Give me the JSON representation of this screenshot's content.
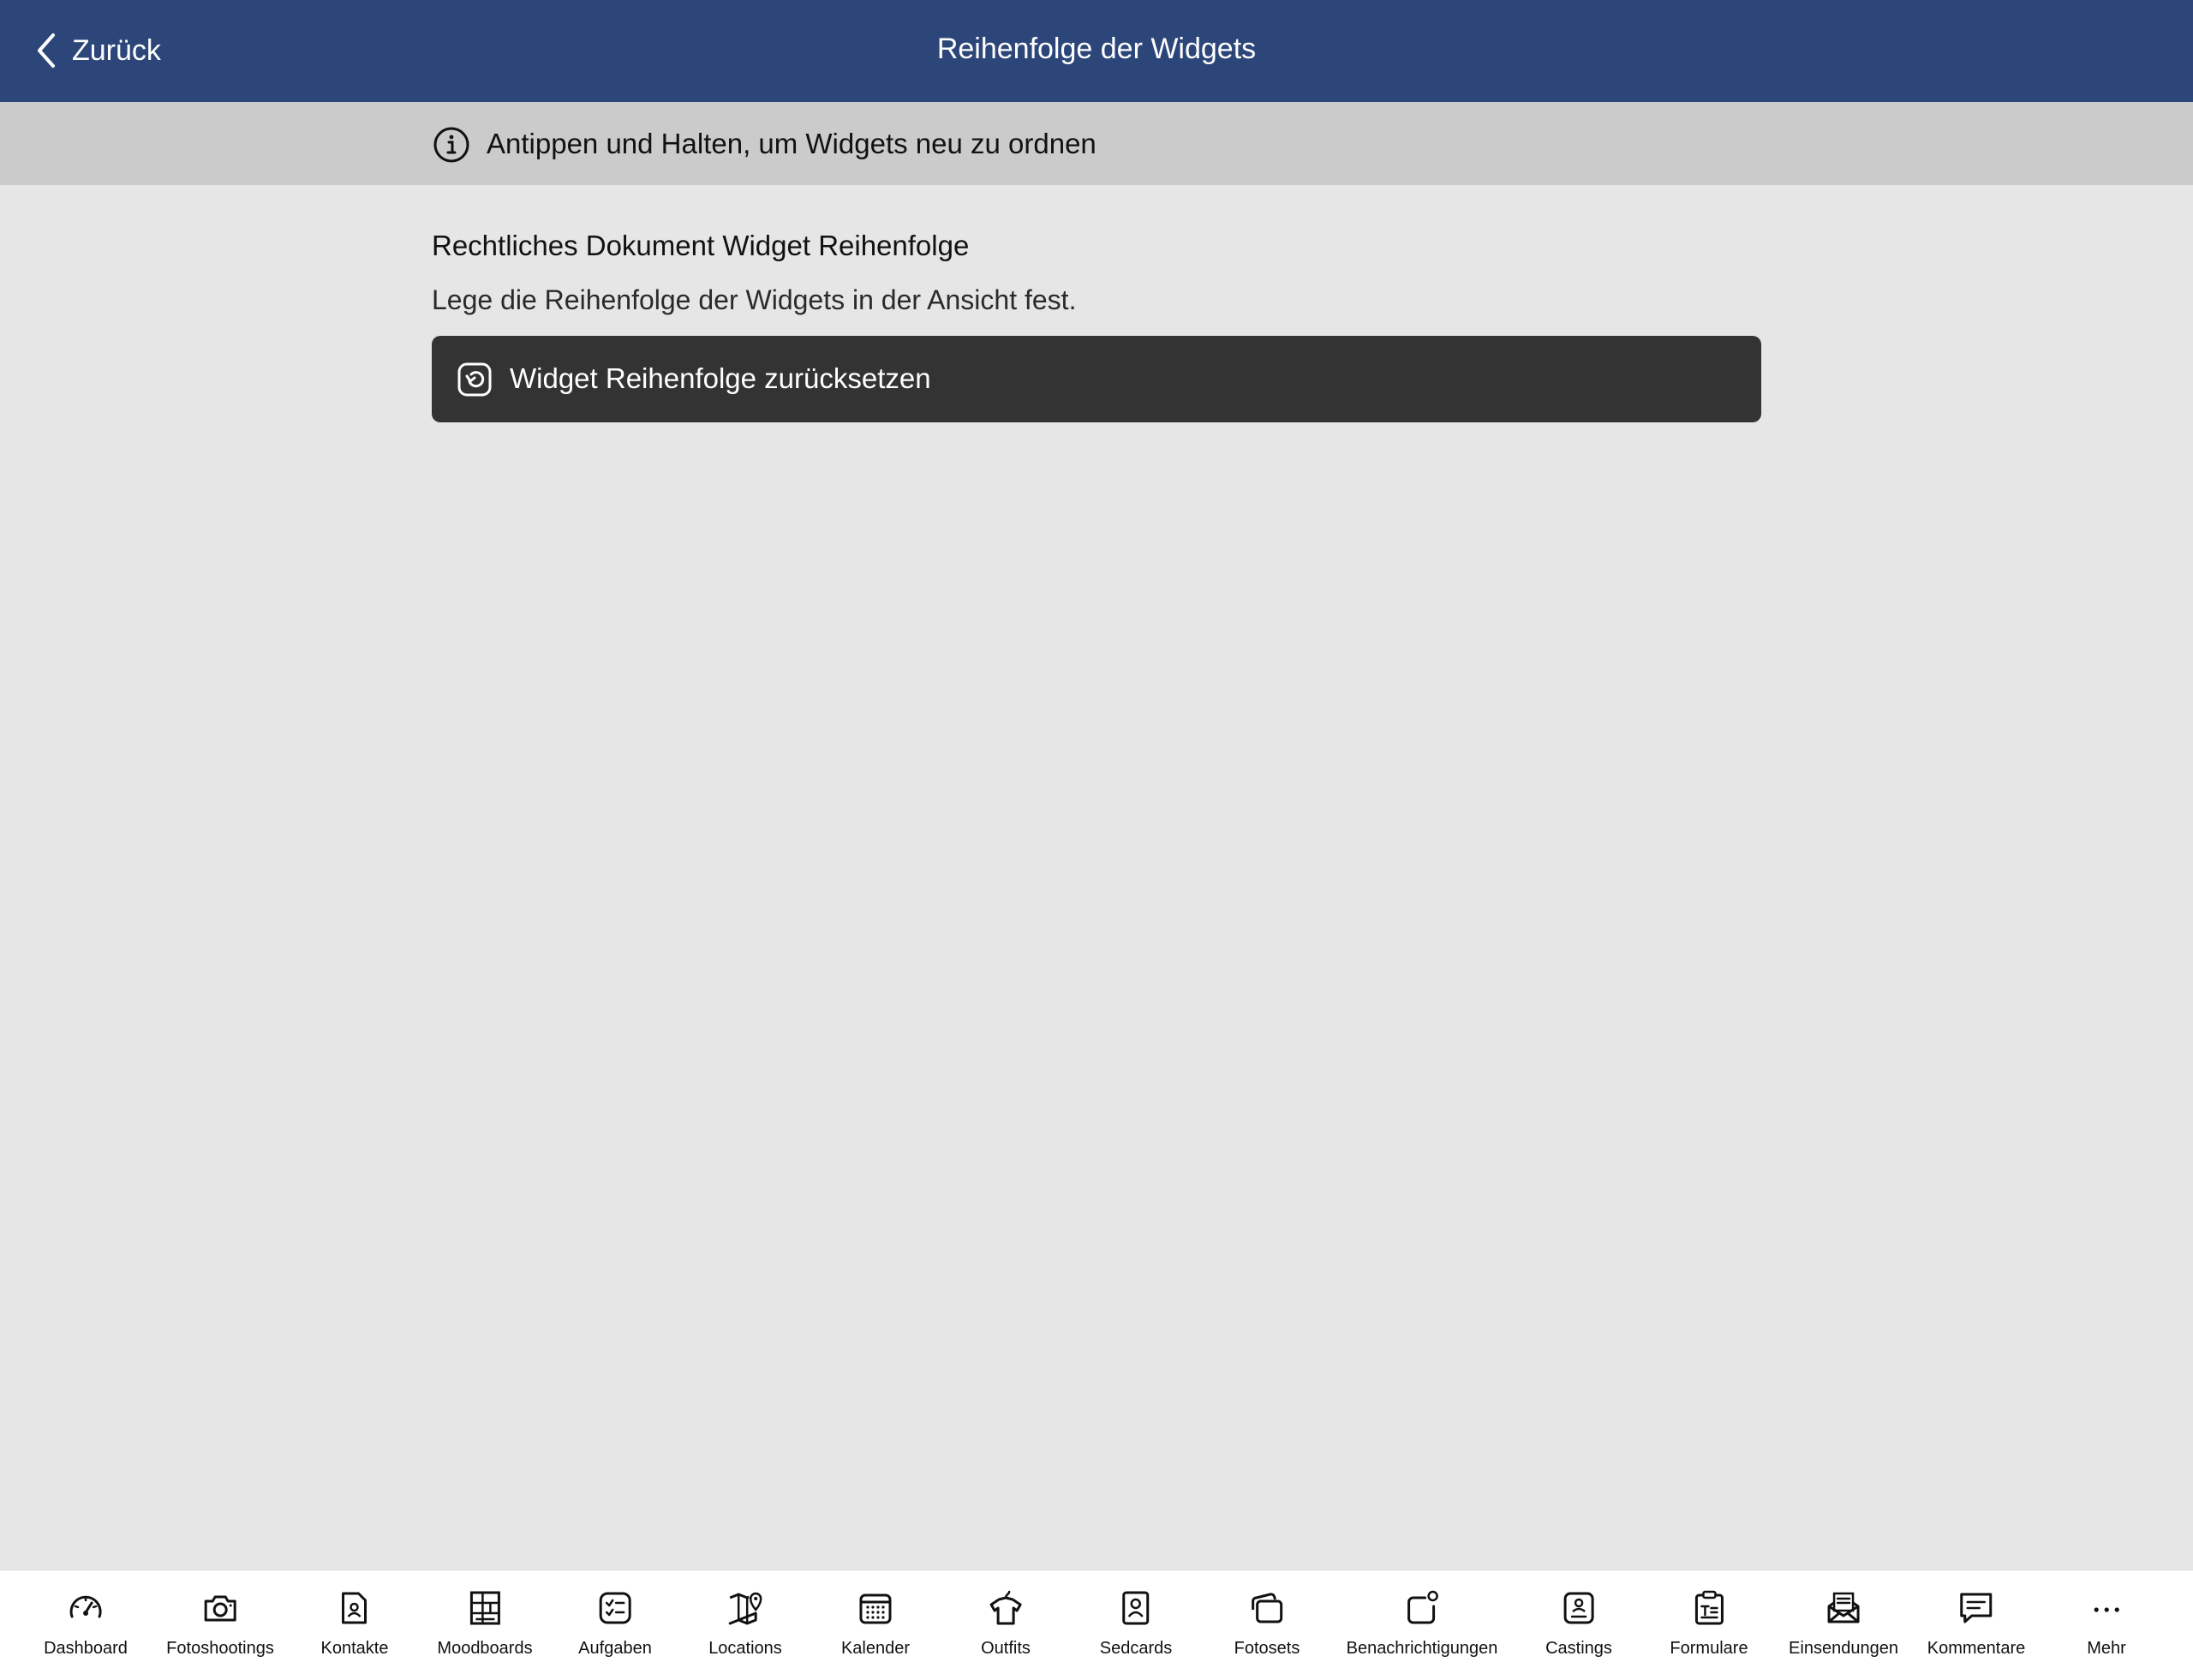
{
  "navbar": {
    "back_label": "Zurück",
    "title": "Reihenfolge der Widgets",
    "background": "#2c4679"
  },
  "info_bar": {
    "icon": "info-icon",
    "text": "Antippen und Halten, um Widgets neu zu ordnen"
  },
  "section": {
    "title": "Rechtliches Dokument Widget Reihenfolge",
    "description": "Lege die Reihenfolge der Widgets in der Ansicht fest."
  },
  "reset_button": {
    "icon": "reset-icon",
    "label": "Widget Reihenfolge zurücksetzen"
  },
  "tabbar": {
    "items": [
      {
        "label": "Dashboard",
        "icon": "dashboard-icon"
      },
      {
        "label": "Fotoshootings",
        "icon": "camera-icon"
      },
      {
        "label": "Kontakte",
        "icon": "contact-icon"
      },
      {
        "label": "Moodboards",
        "icon": "moodboard-icon"
      },
      {
        "label": "Aufgaben",
        "icon": "tasks-icon"
      },
      {
        "label": "Locations",
        "icon": "map-icon"
      },
      {
        "label": "Kalender",
        "icon": "calendar-icon"
      },
      {
        "label": "Outfits",
        "icon": "outfit-icon"
      },
      {
        "label": "Sedcards",
        "icon": "sedcard-icon"
      },
      {
        "label": "Fotosets",
        "icon": "photosets-icon"
      },
      {
        "label": "Benachrichtigungen",
        "icon": "notification-icon"
      },
      {
        "label": "Castings",
        "icon": "casting-icon"
      },
      {
        "label": "Formulare",
        "icon": "form-icon"
      },
      {
        "label": "Einsendungen",
        "icon": "submission-icon"
      },
      {
        "label": "Kommentare",
        "icon": "comment-icon"
      },
      {
        "label": "Mehr",
        "icon": "more-icon"
      }
    ]
  }
}
